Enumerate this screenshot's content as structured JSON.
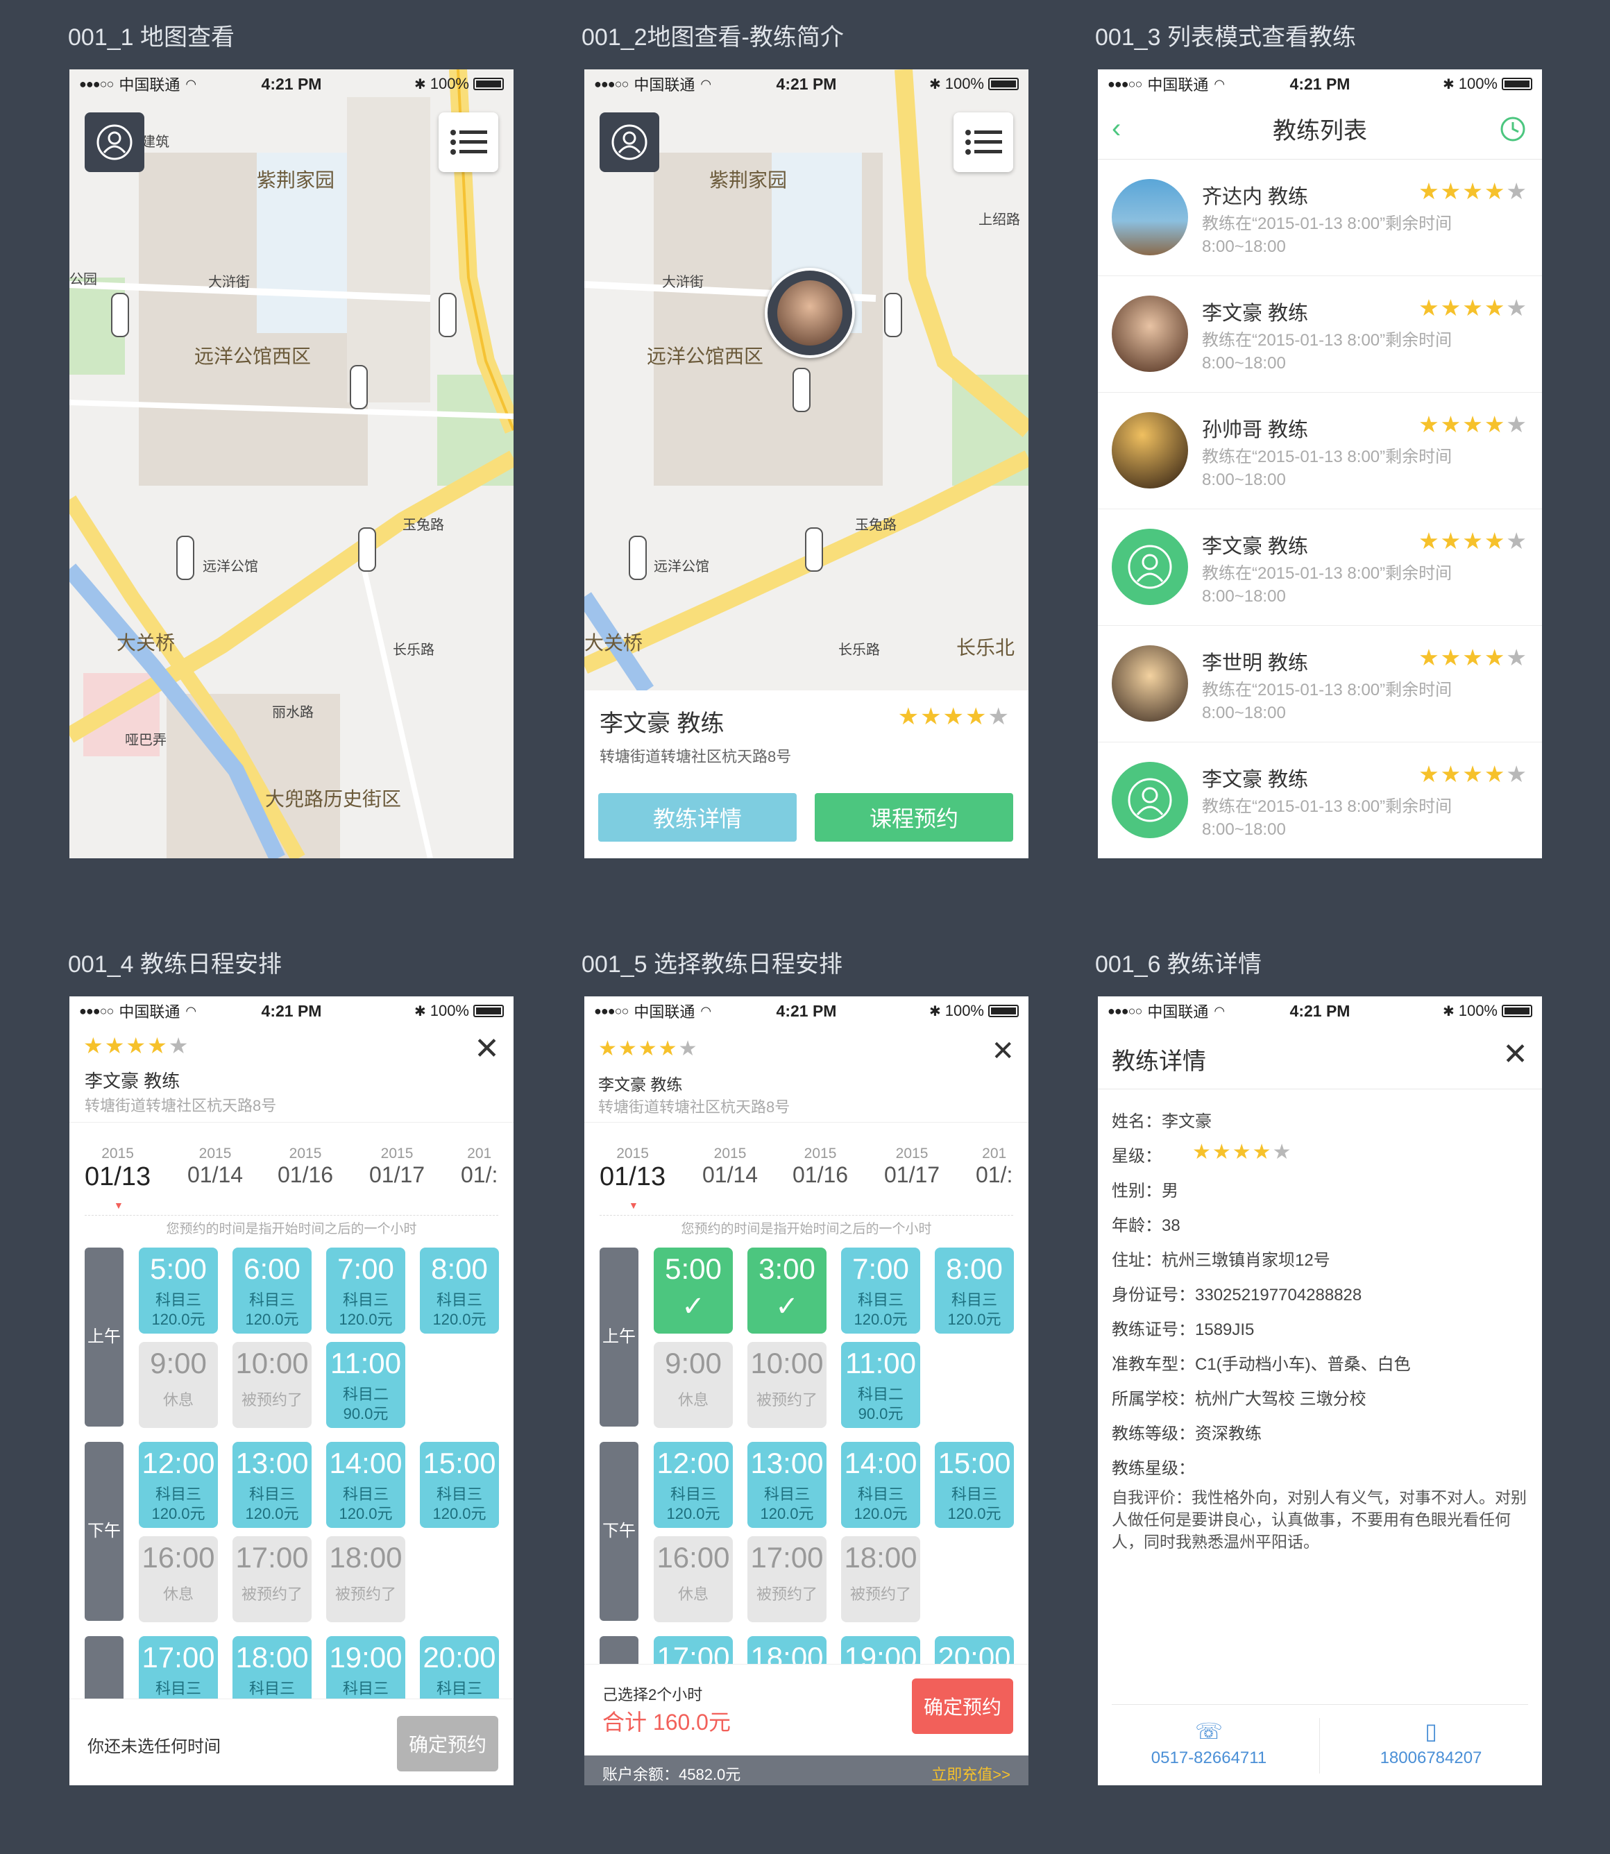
{
  "screens": {
    "s1": {
      "label": "001_1 地图查看"
    },
    "s2": {
      "label": "001_2地图查看-教练简介"
    },
    "s3": {
      "label": "001_3 列表模式查看教练"
    },
    "s4": {
      "label": "001_4 教练日程安排"
    },
    "s5": {
      "label": "001_5 选择教练日程安排"
    },
    "s6": {
      "label": "001_6 教练详情"
    }
  },
  "status_bar": {
    "carrier": "中国联通",
    "time": "4:21 PM",
    "battery": "100%"
  },
  "map": {
    "labels": [
      "紫荆家园",
      "大浒街",
      "远洋公馆西区",
      "玉兔路",
      "远洋公馆",
      "大关桥",
      "长乐路",
      "丽水路",
      "哑巴弄",
      "大兜路历史街区",
      "上绍路",
      "长乐北",
      "建筑",
      "公园"
    ]
  },
  "intro_card": {
    "name": "李文豪 教练",
    "address": "转塘街道转塘社区杭天路8号",
    "detail_btn": "教练详情",
    "book_btn": "课程预约",
    "rating": 4
  },
  "list": {
    "title": "教练列表",
    "items": [
      {
        "name": "齐达内 教练",
        "line2": "教练在“2015-01-13 8:00”剩余时间",
        "line3": "8:00~18:00",
        "rating": 4
      },
      {
        "name": "李文豪 教练",
        "line2": "教练在“2015-01-13 8:00”剩余时间",
        "line3": "8:00~18:00",
        "rating": 4
      },
      {
        "name": "孙帅哥 教练",
        "line2": "教练在“2015-01-13 8:00”剩余时间",
        "line3": "8:00~18:00",
        "rating": 4
      },
      {
        "name": "李文豪 教练",
        "line2": "教练在“2015-01-13 8:00”剩余时间",
        "line3": "8:00~18:00",
        "rating": 4
      },
      {
        "name": "李世明 教练",
        "line2": "教练在“2015-01-13 8:00”剩余时间",
        "line3": "8:00~18:00",
        "rating": 4
      },
      {
        "name": "李文豪 教练",
        "line2": "教练在“2015-01-13 8:00”剩余时间",
        "line3": "8:00~18:00",
        "rating": 4
      }
    ]
  },
  "schedule": {
    "coach_name": "李文豪 教练",
    "address": "转塘街道转塘社区杭天路8号",
    "rating": 4,
    "dates": [
      {
        "year": "2015",
        "day": "01/13"
      },
      {
        "year": "2015",
        "day": "01/14"
      },
      {
        "year": "2015",
        "day": "01/16"
      },
      {
        "year": "2015",
        "day": "01/17"
      },
      {
        "year": "201",
        "day": "01/:"
      }
    ],
    "note": "您预约的时间是指开始时间之后的一个小时",
    "morning": "上午",
    "afternoon": "下午",
    "footer_empty": "你还未选任何时间",
    "confirm": "确定预约",
    "selected_count": "己选择2个小时",
    "total": "合计 160.0元",
    "balance": "账户余额：4582.0元",
    "recharge": "立即充值>>"
  },
  "slots4": [
    {
      "t": "5:00",
      "a": "科目三",
      "b": "120.0元",
      "k": "b"
    },
    {
      "t": "6:00",
      "a": "科目三",
      "b": "120.0元",
      "k": "b"
    },
    {
      "t": "7:00",
      "a": "科目三",
      "b": "120.0元",
      "k": "b"
    },
    {
      "t": "8:00",
      "a": "科目三",
      "b": "120.0元",
      "k": "b"
    },
    {
      "t": "9:00",
      "a": "休息",
      "b": "",
      "k": "g"
    },
    {
      "t": "10:00",
      "a": "被预约了",
      "b": "",
      "k": "g"
    },
    {
      "t": "11:00",
      "a": "科目二",
      "b": "90.0元",
      "k": "b"
    },
    {
      "t": "12:00",
      "a": "科目三",
      "b": "120.0元",
      "k": "b"
    },
    {
      "t": "13:00",
      "a": "科目三",
      "b": "120.0元",
      "k": "b"
    },
    {
      "t": "14:00",
      "a": "科目三",
      "b": "120.0元",
      "k": "b"
    },
    {
      "t": "15:00",
      "a": "科目三",
      "b": "120.0元",
      "k": "b"
    },
    {
      "t": "16:00",
      "a": "休息",
      "b": "",
      "k": "g"
    },
    {
      "t": "17:00",
      "a": "被预约了",
      "b": "",
      "k": "g"
    },
    {
      "t": "18:00",
      "a": "被预约了",
      "b": "",
      "k": "g"
    },
    {
      "t": "17:00",
      "a": "科目三",
      "b": "",
      "k": "b"
    },
    {
      "t": "18:00",
      "a": "科目三",
      "b": "",
      "k": "b"
    },
    {
      "t": "19:00",
      "a": "科目三",
      "b": "",
      "k": "b"
    },
    {
      "t": "20:00",
      "a": "科目三",
      "b": "",
      "k": "b"
    }
  ],
  "slots5": [
    {
      "t": "5:00",
      "a": "✓",
      "b": "",
      "k": "ok"
    },
    {
      "t": "3:00",
      "a": "✓",
      "b": "",
      "k": "ok"
    },
    {
      "t": "7:00",
      "a": "科目三",
      "b": "120.0元",
      "k": "b"
    },
    {
      "t": "8:00",
      "a": "科目三",
      "b": "120.0元",
      "k": "b"
    },
    {
      "t": "9:00",
      "a": "休息",
      "b": "",
      "k": "g"
    },
    {
      "t": "10:00",
      "a": "被预约了",
      "b": "",
      "k": "g"
    },
    {
      "t": "11:00",
      "a": "科目二",
      "b": "90.0元",
      "k": "b"
    },
    {
      "t": "12:00",
      "a": "科目三",
      "b": "120.0元",
      "k": "b"
    },
    {
      "t": "13:00",
      "a": "科目三",
      "b": "120.0元",
      "k": "b"
    },
    {
      "t": "14:00",
      "a": "科目三",
      "b": "120.0元",
      "k": "b"
    },
    {
      "t": "15:00",
      "a": "科目三",
      "b": "120.0元",
      "k": "b"
    },
    {
      "t": "16:00",
      "a": "休息",
      "b": "",
      "k": "g"
    },
    {
      "t": "17:00",
      "a": "被预约了",
      "b": "",
      "k": "g"
    },
    {
      "t": "18:00",
      "a": "被预约了",
      "b": "",
      "k": "g"
    },
    {
      "t": "17:00",
      "a": "",
      "b": "",
      "k": "b"
    },
    {
      "t": "18:00",
      "a": "",
      "b": "",
      "k": "b"
    },
    {
      "t": "19:00",
      "a": "",
      "b": "",
      "k": "b"
    },
    {
      "t": "20:00",
      "a": "",
      "b": "",
      "k": "b"
    }
  ],
  "detail": {
    "title": "教练详情",
    "rows": [
      "姓名：李文豪",
      "星级：",
      "性别：男",
      "年龄：38",
      "住址：杭州三墩镇肖家坝12号",
      "身份证号：330252197704288828",
      "教练证号：1589JI5",
      "准教车型：C1(手动档小车)、普桑、白色",
      "所属学校：杭州广大驾校 三墩分校",
      "教练等级：资深教练",
      "教练星级："
    ],
    "bio": "自我评价：我性格外向，对别人有义气，对事不对人。对别人做任何是要讲良心，认真做事，不要用有色眼光看任何人，同时我熟悉温州平阳话。",
    "phone1": "0517-82664711",
    "phone2": "18006784207",
    "rating": 4
  },
  "colors": {
    "bg": "#3c4450",
    "blue": "#6ccfdf",
    "green": "#4cc67f",
    "red": "#f2605a",
    "star": "#f6c12b"
  }
}
